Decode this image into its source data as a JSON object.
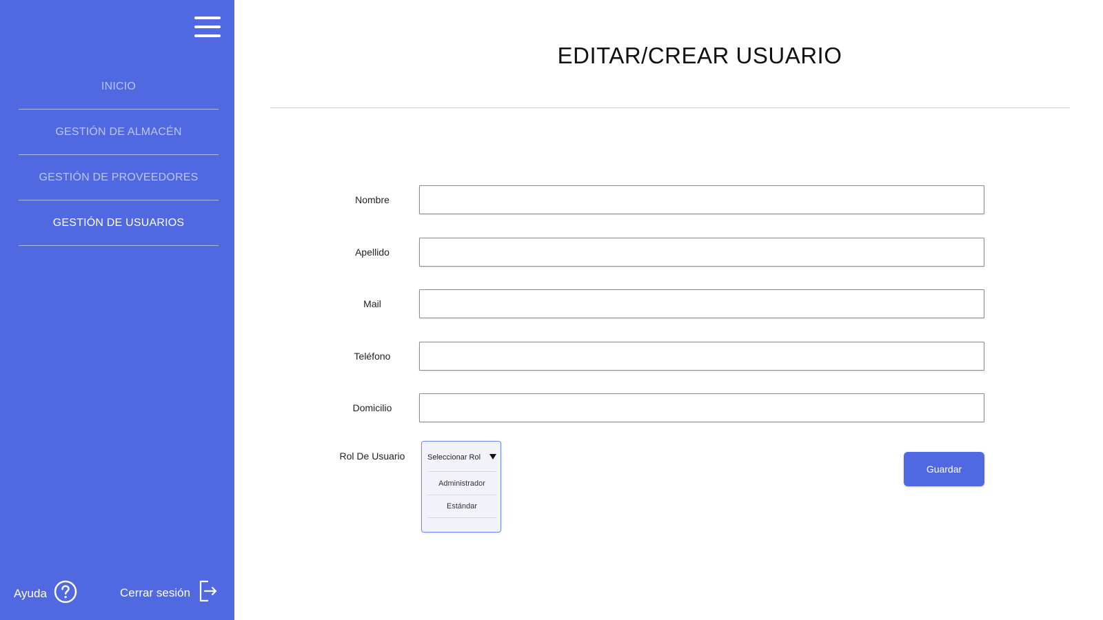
{
  "sidebar": {
    "menu_icon": "hamburger-menu-icon",
    "items": [
      {
        "label": "INICIO",
        "active": false
      },
      {
        "label": "GESTIÓN DE ALMACÉN",
        "active": false
      },
      {
        "label": "GESTIÓN DE PROVEEDORES",
        "active": false
      },
      {
        "label": "GESTIÓN DE USUARIOS",
        "active": true
      }
    ],
    "help_label": "Ayuda",
    "help_icon": "question-circle-icon",
    "logout_label": "Cerrar sesión",
    "logout_icon": "logout-icon"
  },
  "main": {
    "title": "EDITAR/CREAR USUARIO",
    "fields": [
      {
        "label": "Nombre",
        "value": ""
      },
      {
        "label": "Apellido",
        "value": ""
      },
      {
        "label": "Mail",
        "value": ""
      },
      {
        "label": "Teléfono",
        "value": ""
      },
      {
        "label": "Domicilio",
        "value": ""
      }
    ],
    "role": {
      "label": "Rol De Usuario",
      "placeholder": "Seleccionar Rol",
      "options": [
        "Administrador",
        "Estándar"
      ]
    },
    "save_label": "Guardar"
  },
  "colors": {
    "accent": "#5069e1",
    "background": "#ffffff"
  }
}
